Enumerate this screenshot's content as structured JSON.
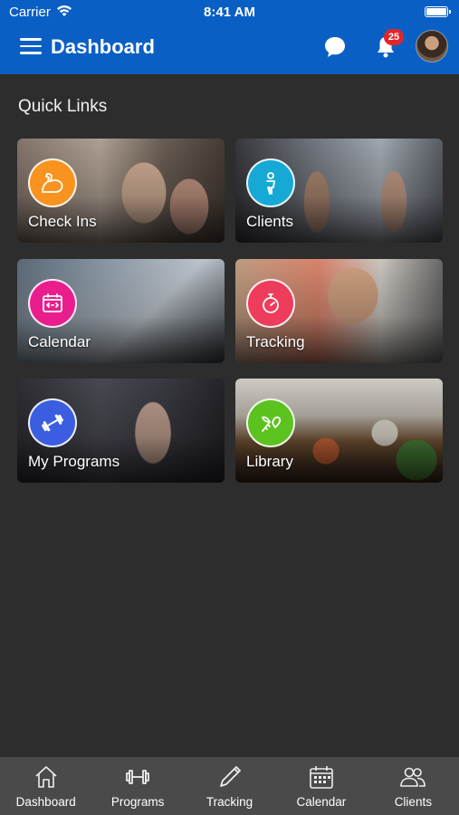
{
  "status_bar": {
    "carrier": "Carrier",
    "time": "8:41 AM"
  },
  "header": {
    "title": "Dashboard",
    "notification_count": "25"
  },
  "quick_links": {
    "title": "Quick Links",
    "items": [
      {
        "label": "Check Ins",
        "icon": "flexed-arm-icon",
        "color": "#f7931e"
      },
      {
        "label": "Clients",
        "icon": "person-icon",
        "color": "#16a9d6"
      },
      {
        "label": "Calendar",
        "icon": "calendar-icon",
        "color": "#e91e8c"
      },
      {
        "label": "Tracking",
        "icon": "stopwatch-icon",
        "color": "#ee3d5c"
      },
      {
        "label": "My Programs",
        "icon": "dumbbell-icon",
        "color": "#3b5ee0"
      },
      {
        "label": "Library",
        "icon": "vegetables-icon",
        "color": "#5cc21f"
      }
    ]
  },
  "tabbar": {
    "items": [
      {
        "label": "Dashboard",
        "icon": "home-icon"
      },
      {
        "label": "Programs",
        "icon": "dumbbell-icon"
      },
      {
        "label": "Tracking",
        "icon": "pencil-icon"
      },
      {
        "label": "Calendar",
        "icon": "calendar-icon"
      },
      {
        "label": "Clients",
        "icon": "people-icon"
      }
    ]
  },
  "colors": {
    "header": "#0a5fc4",
    "background": "#2d2d2d",
    "tabbar": "#4a4a4a",
    "badge": "#e0262b"
  }
}
